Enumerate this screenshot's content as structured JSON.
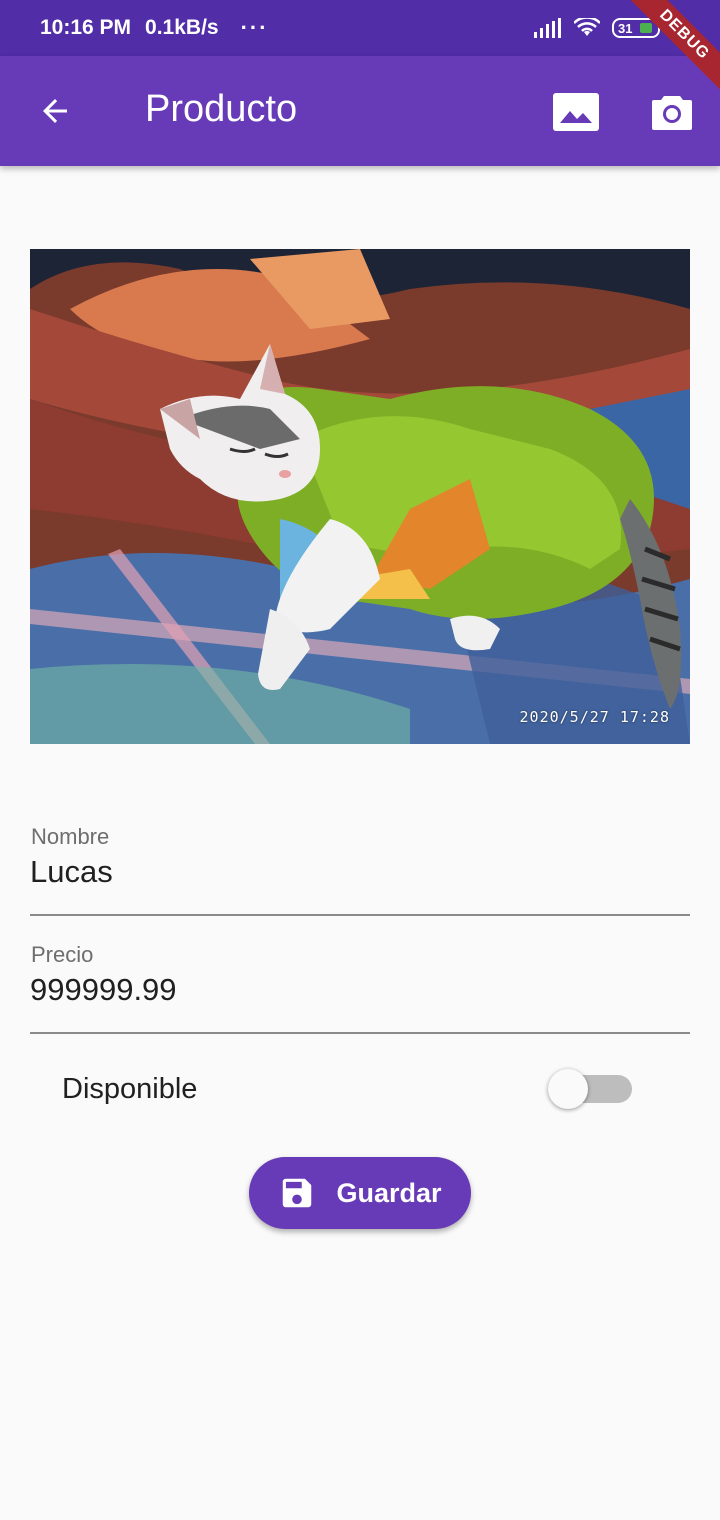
{
  "status_bar": {
    "time": "10:16 PM",
    "speed": "0.1kB/s",
    "more": "···",
    "battery": "31",
    "debug_banner": "DEBUG"
  },
  "app_bar": {
    "title": "Producto",
    "back_icon": "arrow-back-icon",
    "gallery_icon": "photo-gallery-icon",
    "camera_icon": "camera-icon"
  },
  "image": {
    "timestamp": "2020/5/27  17:28"
  },
  "form": {
    "name_label": "Nombre",
    "name_value": "Lucas",
    "price_label": "Precio",
    "price_value": "999999.99",
    "available_label": "Disponible",
    "available_value": false,
    "save_label": "Guardar",
    "save_icon": "save-icon"
  },
  "colors": {
    "primary": "#673ab7",
    "status_bar": "#512da8",
    "background": "#fafafa",
    "debug_ribbon": "#a7262f"
  }
}
